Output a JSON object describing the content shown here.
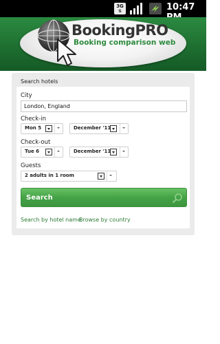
{
  "status_bar": {
    "network_label": "3G",
    "time": "10:47 PM",
    "icons": [
      "3g-icon",
      "signal-icon",
      "battery-icon"
    ]
  },
  "header": {
    "title": "BookingPRO",
    "subtitle": "Booking comparison web",
    "colors": {
      "header_green": "#1e6f31",
      "subtitle_green": "#2e8a3e"
    }
  },
  "form": {
    "title": "Search hotels",
    "city_label": "City",
    "city_value": "London, England",
    "checkin_label": "Check-in",
    "checkin_day": "Mon 5",
    "checkin_month": "December '11",
    "checkout_label": "Check-out",
    "checkout_day": "Tue 6",
    "checkout_month": "December '11",
    "guests_label": "Guests",
    "guests_value": "2 adults in 1 room",
    "search_label": "Search",
    "search_color": "#45a246"
  },
  "links": {
    "by_name": "Search by hotel name",
    "by_country": "Browse by country"
  }
}
